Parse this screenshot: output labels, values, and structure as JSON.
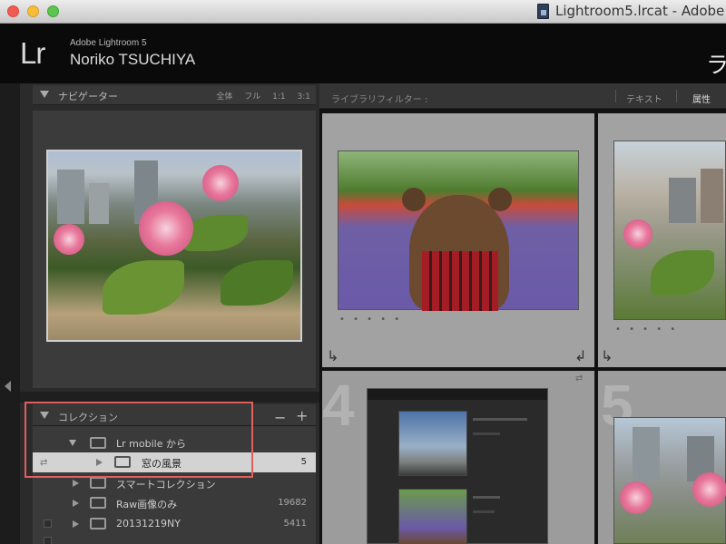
{
  "window": {
    "title": "Lightroom5.lrcat - Adobe"
  },
  "identity_plate": {
    "logo": "Lr",
    "product": "Adobe Lightroom 5",
    "user": "Noriko TSUCHIYA",
    "module_partial": "ラ"
  },
  "navigator": {
    "title": "ナビゲーター",
    "options": [
      "全体",
      "フル",
      "1:1",
      "3:1"
    ]
  },
  "collections": {
    "title": "コレクション",
    "minus_label": "−",
    "plus_label": "+",
    "items": [
      {
        "name": "Lr mobile から",
        "count": ""
      },
      {
        "name": "窓の風景",
        "count": "5"
      },
      {
        "name": "スマートコレクション",
        "count": ""
      },
      {
        "name": "Raw画像のみ",
        "count": "19682"
      },
      {
        "name": "20131219NY",
        "count": "5411"
      }
    ]
  },
  "library_filter": {
    "title": "ライブラリフィルター :",
    "text_tab": "テキスト",
    "attribute_tab": "属性"
  },
  "grid": {
    "cell_numbers": [
      "4",
      "5"
    ],
    "rating_dots": "• • • • •"
  },
  "colors": {
    "highlight_box": "#e06060",
    "panel_bg": "#3a3a3a",
    "selected_row": "#d3d3d3"
  },
  "icons": {
    "rotate_left": "rotate-left-icon",
    "rotate_right": "rotate-right-icon",
    "swap": "swap-icon"
  }
}
